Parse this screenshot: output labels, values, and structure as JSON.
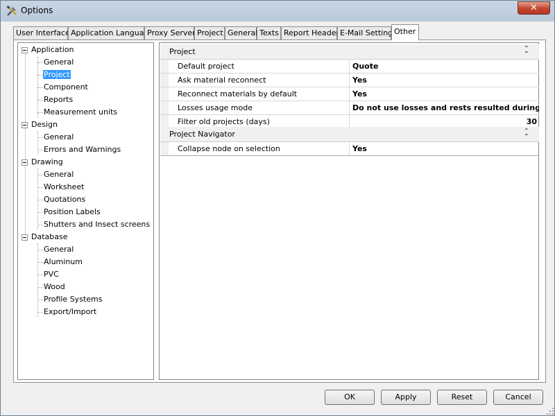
{
  "window": {
    "title": "Options"
  },
  "tabs": [
    {
      "label": "User Interface"
    },
    {
      "label": "Application Language"
    },
    {
      "label": "Proxy Server"
    },
    {
      "label": "Project"
    },
    {
      "label": "General"
    },
    {
      "label": "Texts"
    },
    {
      "label": "Report Header"
    },
    {
      "label": "E-Mail Settings"
    },
    {
      "label": "Other",
      "active": true
    }
  ],
  "tree": {
    "groups": [
      {
        "label": "Application",
        "children": [
          "General",
          "Project",
          "Component",
          "Reports",
          "Measurement units"
        ]
      },
      {
        "label": "Design",
        "children": [
          "General",
          "Errors and Warnings"
        ]
      },
      {
        "label": "Drawing",
        "children": [
          "General",
          "Worksheet",
          "Quotations",
          "Position Labels",
          "Shutters and Insect screens"
        ]
      },
      {
        "label": "Database",
        "children": [
          "General",
          "Aluminum",
          "PVC",
          "Wood",
          "Profile Systems",
          "Export/Import"
        ]
      }
    ],
    "selected": "Application/Project"
  },
  "properties": {
    "categories": [
      {
        "label": "Project",
        "rows": [
          {
            "name": "Default project",
            "value": "Quote"
          },
          {
            "name": "Ask material reconnect",
            "value": "Yes"
          },
          {
            "name": "Reconnect materials by default",
            "value": "Yes"
          },
          {
            "name": "Losses usage mode",
            "value": "Do not use losses and rests resulted during o..."
          },
          {
            "name": "Filter old projects (days)",
            "value": "30"
          }
        ]
      },
      {
        "label": "Project Navigator",
        "rows": [
          {
            "name": "Collapse node on selection",
            "value": "Yes"
          }
        ]
      }
    ]
  },
  "buttons": {
    "ok": "OK",
    "apply": "Apply",
    "reset": "Reset",
    "cancel": "Cancel"
  },
  "colors": {
    "selection": "#3399ff",
    "titlebar": "#c9d6e4",
    "close": "#c4452f"
  }
}
